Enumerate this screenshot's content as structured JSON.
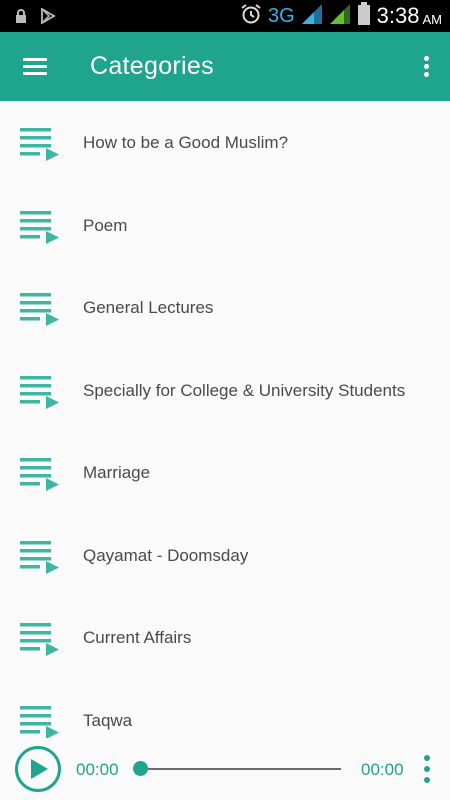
{
  "status_bar": {
    "network": "3G",
    "time": "3:38",
    "ampm": "AM",
    "icons": [
      "lock-icon",
      "play-store-icon",
      "alarm-icon",
      "signal-icon",
      "signal-icon",
      "battery-icon"
    ]
  },
  "app_bar": {
    "title": "Categories",
    "menu_icon": "hamburger-menu-icon",
    "overflow_icon": "more-vert-icon",
    "color": "#1fa58d"
  },
  "categories": [
    {
      "label": "How to be a Good Muslim?"
    },
    {
      "label": "Poem"
    },
    {
      "label": "General Lectures"
    },
    {
      "label": "Specially for College & University Students"
    },
    {
      "label": "Marriage"
    },
    {
      "label": "Qayamat - Doomsday"
    },
    {
      "label": "Current Affairs"
    },
    {
      "label": "Taqwa"
    }
  ],
  "player": {
    "current_time": "00:00",
    "total_time": "00:00",
    "progress": 0,
    "accent": "#1fa58d"
  }
}
